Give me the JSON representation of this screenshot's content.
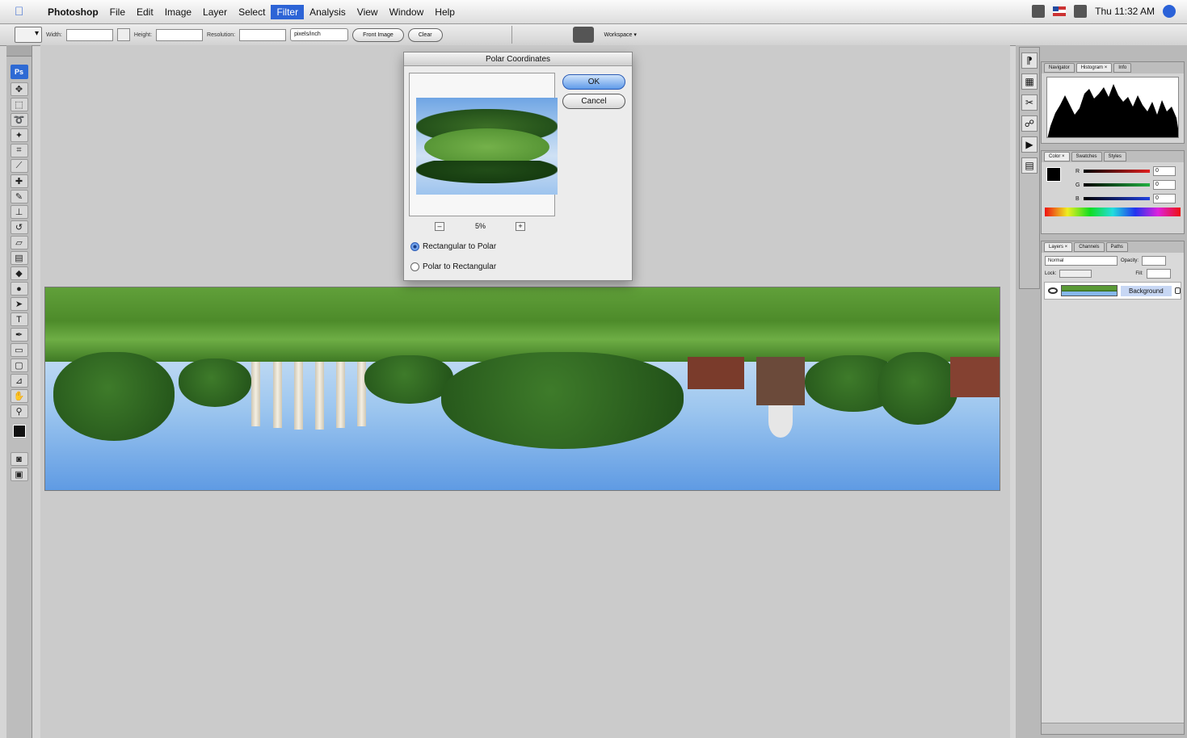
{
  "menubar": {
    "items": [
      "Photoshop",
      "File",
      "Edit",
      "Image",
      "Layer",
      "Select",
      "Filter",
      "Analysis",
      "View",
      "Window",
      "Help"
    ],
    "active_item": "Filter",
    "clock": "Thu 11:32 AM"
  },
  "options": {
    "width_label": "Width:",
    "height_label": "Height:",
    "resolution_label": "Resolution:",
    "units_select": "pixels/inch",
    "front_image_label": "Front Image",
    "clear_label": "Clear",
    "workspace_label": "Workspace ▾"
  },
  "toolbox": {
    "logo": "Ps"
  },
  "dialog": {
    "title": "Polar Coordinates",
    "ok_label": "OK",
    "cancel_label": "Cancel",
    "zoom_minus": "–",
    "zoom_level": "5%",
    "zoom_plus": "+",
    "option_rect_to_polar": "Rectangular to Polar",
    "option_polar_to_rect": "Polar to Rectangular",
    "selected_option": "Rectangular to Polar"
  },
  "panels": {
    "histogram_tabs": [
      "Navigator",
      "Histogram ×",
      "Info"
    ],
    "color_tabs": [
      "Color ×",
      "Swatches",
      "Styles"
    ],
    "color_sliders": [
      {
        "letter": "R",
        "value": "0",
        "color": "#e02020"
      },
      {
        "letter": "G",
        "value": "0",
        "color": "#20b040"
      },
      {
        "letter": "B",
        "value": "0",
        "color": "#2040e0"
      }
    ],
    "layers_tabs": [
      "Layers ×",
      "Channels",
      "Paths"
    ],
    "blend_mode": "Normal",
    "opacity_label": "Opacity:",
    "lock_label": "Lock:",
    "fill_label": "Fill:",
    "layer_name": "Background"
  }
}
